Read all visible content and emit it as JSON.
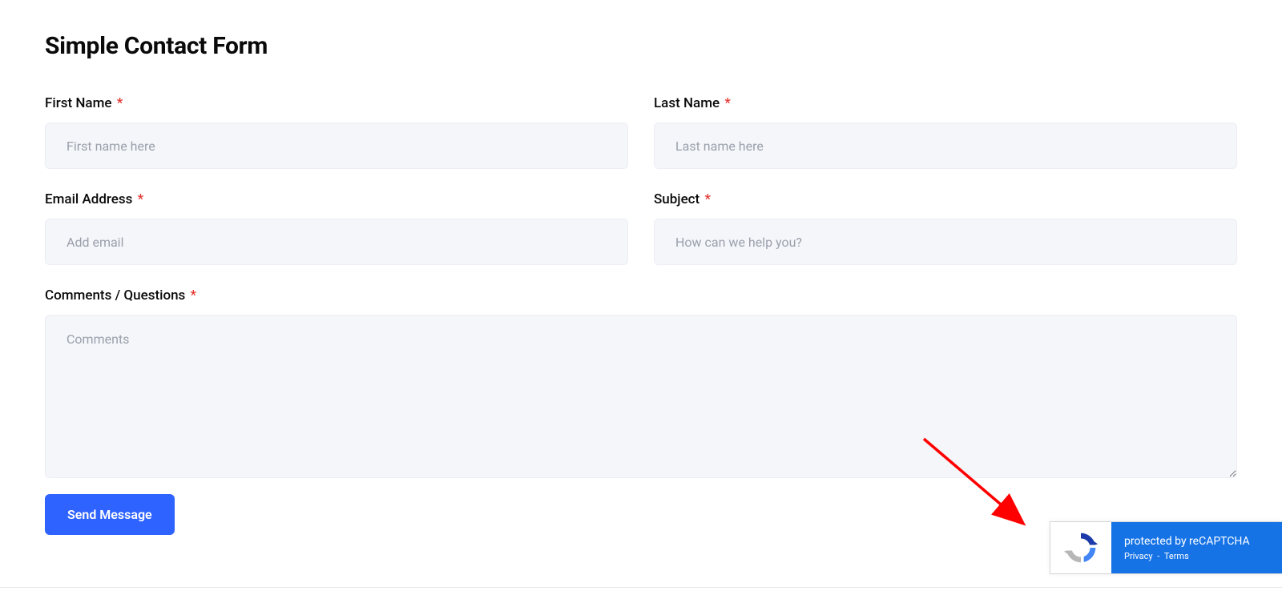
{
  "form": {
    "title": "Simple Contact Form",
    "fields": {
      "first_name": {
        "label": "First Name",
        "placeholder": "First name here",
        "required": true
      },
      "last_name": {
        "label": "Last Name",
        "placeholder": "Last name here",
        "required": true
      },
      "email": {
        "label": "Email Address",
        "placeholder": "Add email",
        "required": true
      },
      "subject": {
        "label": "Subject",
        "placeholder": "How can we help you?",
        "required": true
      },
      "comments": {
        "label": "Comments / Questions",
        "placeholder": "Comments",
        "required": true
      }
    },
    "submit_label": "Send Message",
    "required_marker": "*"
  },
  "recaptcha": {
    "protected_text": "protected by reCAPTCHA",
    "privacy_label": "Privacy",
    "separator": "-",
    "terms_label": "Terms"
  },
  "colors": {
    "accent": "#2f63ff",
    "input_bg": "#f5f6fa",
    "required": "#e3342f",
    "recaptcha_blue": "#1673e6",
    "arrow": "#ff0000"
  }
}
